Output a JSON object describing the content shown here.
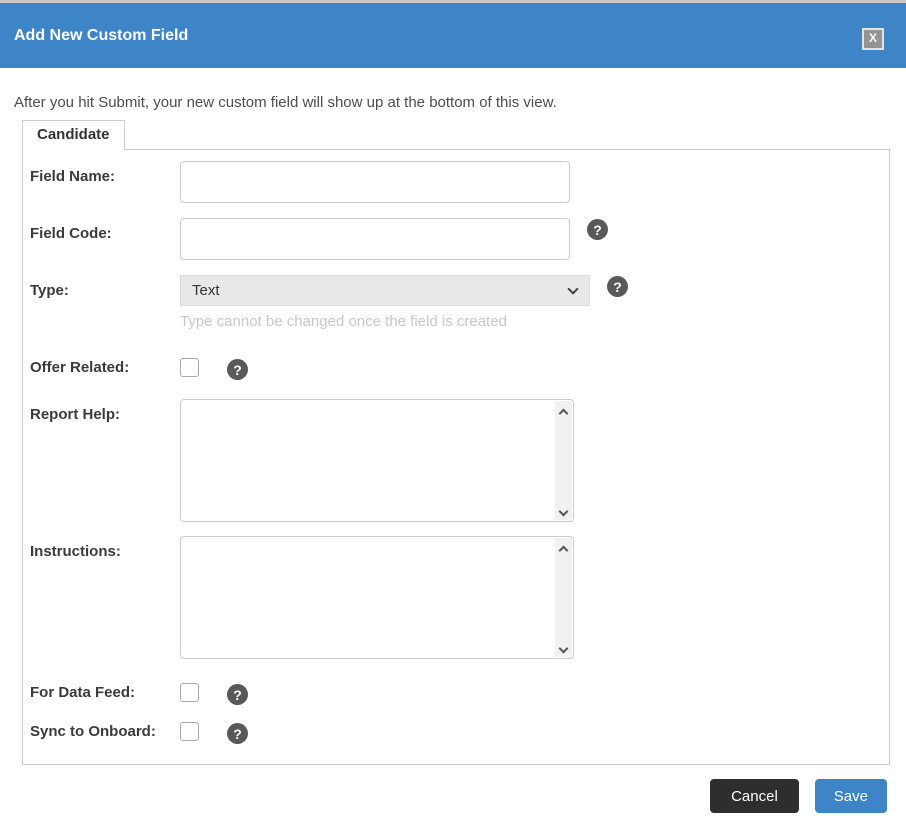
{
  "window": {
    "title": "Add New Custom Field",
    "close_icon": "X"
  },
  "intro": "After you hit Submit, your new custom field will show up at the bottom of this view.",
  "tab": {
    "label": "Candidate"
  },
  "form": {
    "field_name": {
      "label": "Field Name:",
      "value": ""
    },
    "field_code": {
      "label": "Field Code:",
      "value": ""
    },
    "type": {
      "label": "Type:",
      "value": "Text",
      "note": "Type cannot be changed once the field is created"
    },
    "offer_related": {
      "label": "Offer Related:",
      "checked": false
    },
    "report_help": {
      "label": "Report Help:",
      "value": ""
    },
    "instructions": {
      "label": "Instructions:",
      "value": ""
    },
    "for_data_feed": {
      "label": "For Data Feed:",
      "checked": false
    },
    "sync_to_onboard": {
      "label": "Sync to Onboard:",
      "checked": false
    }
  },
  "icons": {
    "help": "?"
  },
  "footer": {
    "cancel_label": "Cancel",
    "save_label": "Save"
  },
  "colors": {
    "header_blue": "#3d85c6",
    "save_blue": "#3d85c6",
    "cancel_dark": "#2e2e2e",
    "help_icon_gray": "#595959",
    "border_gray": "#cccccc",
    "note_gray": "#c8c8c8"
  }
}
